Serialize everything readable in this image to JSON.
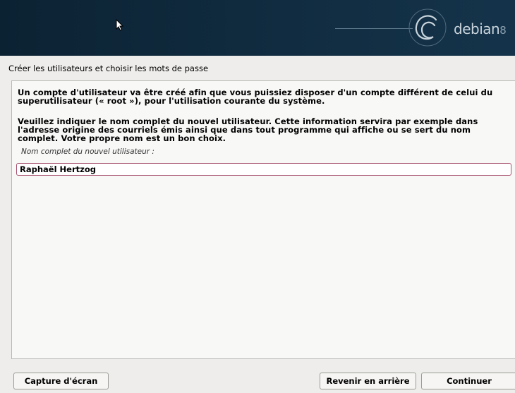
{
  "header": {
    "brand": "debian",
    "version": "8"
  },
  "page": {
    "title": "Créer les utilisateurs et choisir les mots de passe"
  },
  "content": {
    "paragraph1": "Un compte d'utilisateur va être créé afin que vous puissiez disposer d'un compte différent de celui du superutilisateur (« root »), pour l'utilisation courante du système.",
    "paragraph2": "Veuillez indiquer le nom complet du nouvel utilisateur. Cette information servira par exemple dans l'adresse origine des courriels émis ainsi que dans tout programme qui affiche ou se sert du nom complet. Votre propre nom est un bon choix.",
    "field_label": "Nom complet du nouvel utilisateur :",
    "field_value": "Raphaël Hertzog"
  },
  "buttons": {
    "screenshot": "Capture d'écran",
    "back": "Revenir en arrière",
    "continue": "Continuer"
  }
}
